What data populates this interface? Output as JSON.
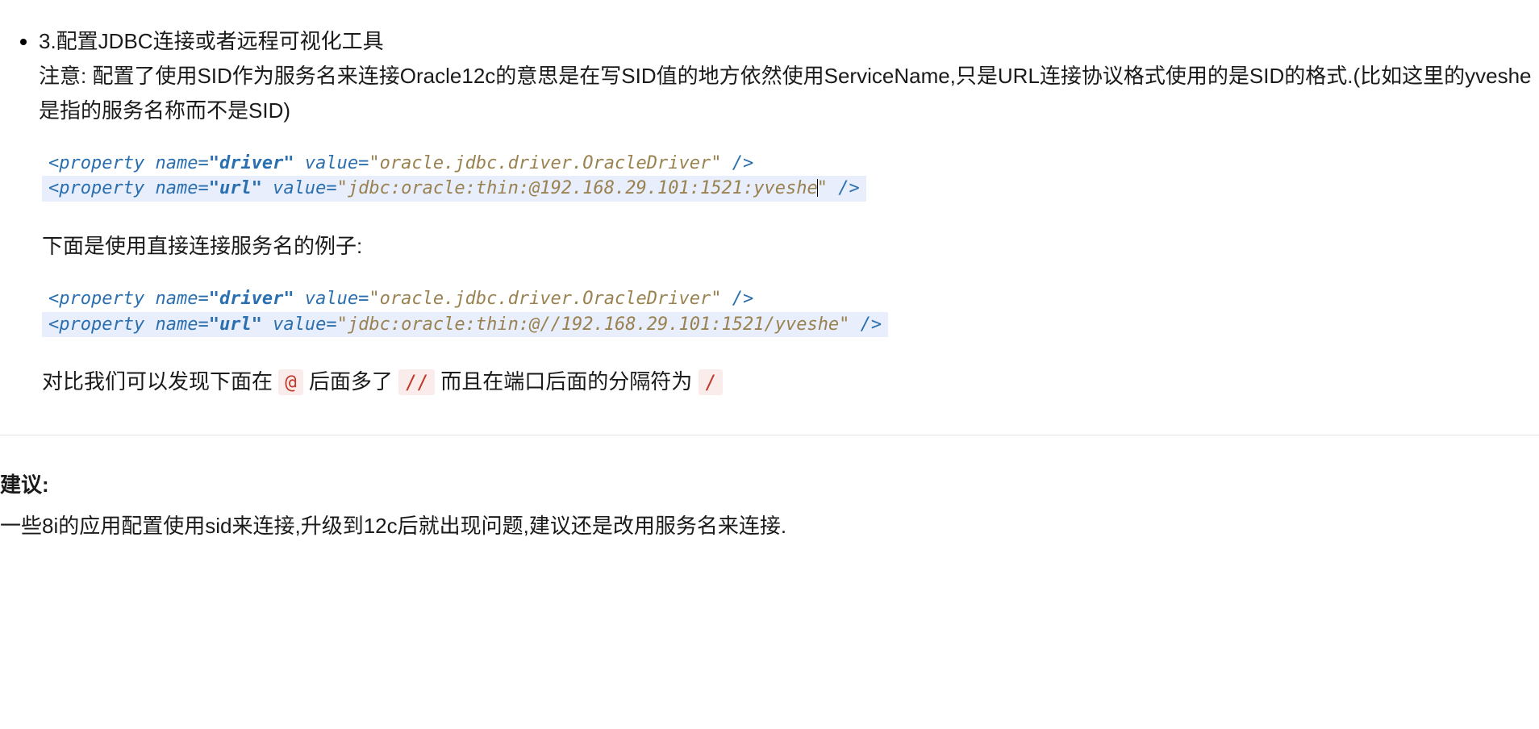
{
  "bullet": {
    "title": "3.配置JDBC连接或者远程可视化工具",
    "note": "注意: 配置了使用SID作为服务名来连接Oracle12c的意思是在写SID值的地方依然使用ServiceName,只是URL连接协议格式使用的是SID的格式.(比如这里的yveshe是指的服务名称而不是SID)"
  },
  "code1": {
    "line1": {
      "open": "<property",
      "attr1": " name=",
      "val1": "\"driver\"",
      "attr2": " value=",
      "val2": "\"oracle.jdbc.driver.OracleDriver\"",
      "close": " />"
    },
    "line2": {
      "open": "<property",
      "attr1": " name=",
      "val1": "\"url\"",
      "attr2": " value=",
      "val2a": "\"",
      "val2b": "jdbc:oracle:thin:@192.168.29.101:1521:yveshe",
      "val2c": "\"",
      "close": " />"
    }
  },
  "between": "下面是使用直接连接服务名的例子:",
  "code2": {
    "line1": {
      "open": "<property",
      "attr1": " name=",
      "val1": "\"driver\"",
      "attr2": " value=",
      "val2": "\"oracle.jdbc.driver.OracleDriver\"",
      "close": " />"
    },
    "line2": {
      "open": "<property",
      "attr1": " name=",
      "val1": "\"url\"",
      "attr2": " value=",
      "val2a": "\"",
      "val2b": "jdbc:oracle:thin:@//192.168.29.101:1521/yveshe\"",
      "close": " />"
    }
  },
  "compare": {
    "p1": "对比我们可以发现下面在 ",
    "c1": "@",
    "p2": " 后面多了 ",
    "c2": "//",
    "p3": " 而且在端口后面的分隔符为 ",
    "c3": "/"
  },
  "suggest": {
    "title": "建议:",
    "body": "一些8i的应用配置使用sid来连接,升级到12c后就出现问题,建议还是改用服务名来连接."
  }
}
